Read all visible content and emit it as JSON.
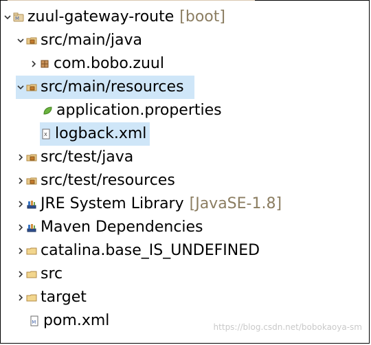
{
  "explorer": {
    "items": [
      {
        "label": "zuul-gateway-route",
        "decoration": "[boot]",
        "icon": "maven-project-icon",
        "state": "expanded"
      },
      {
        "label": "src/main/java",
        "icon": "source-folder-icon",
        "state": "expanded"
      },
      {
        "label": "com.bobo.zuul",
        "icon": "package-icon",
        "state": "collapsed"
      },
      {
        "label": "src/main/resources",
        "icon": "source-folder-icon",
        "state": "expanded",
        "selected": true
      },
      {
        "label": "application.properties",
        "icon": "spring-leaf-icon",
        "state": "leaf"
      },
      {
        "label": "logback.xml",
        "icon": "xml-file-icon",
        "state": "leaf",
        "selected": true
      },
      {
        "label": "src/test/java",
        "icon": "source-folder-icon",
        "state": "collapsed"
      },
      {
        "label": "src/test/resources",
        "icon": "source-folder-icon",
        "state": "collapsed"
      },
      {
        "label": "JRE System Library",
        "decoration": "[JavaSE-1.8]",
        "icon": "library-icon",
        "state": "collapsed"
      },
      {
        "label": "Maven Dependencies",
        "icon": "library-icon",
        "state": "collapsed"
      },
      {
        "label": "catalina.base_IS_UNDEFINED",
        "icon": "folder-icon",
        "state": "collapsed"
      },
      {
        "label": "src",
        "icon": "folder-icon",
        "state": "collapsed"
      },
      {
        "label": "target",
        "icon": "folder-icon",
        "state": "collapsed"
      },
      {
        "label": "pom.xml",
        "icon": "maven-pom-icon",
        "state": "leaf"
      }
    ]
  },
  "watermark": "https://blog.csdn.net/bobokaoya-sm",
  "colors": {
    "selection": "#cfe6f8",
    "decoration": "#8b7d61"
  }
}
